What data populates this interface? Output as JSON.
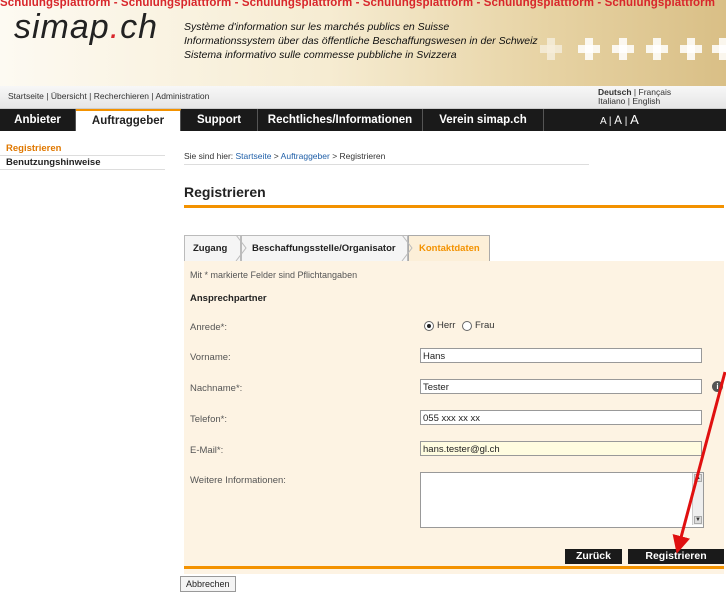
{
  "header": {
    "banner": "Schulungsplattform - Schulungsplattform - Schulungsplattform - Schulungsplattform - Schulungsplattform - Schulungsplattform",
    "logo_main": "simap",
    "logo_dot": ".",
    "logo_ext": "ch",
    "desc_fr": "Système d'information sur les marchés publics en Suisse",
    "desc_de": "Informationssystem über das öffentliche Beschaffungswesen in der Schweiz",
    "desc_it": "Sistema informativo sulle commesse pubbliche in Svizzera"
  },
  "toplinks": {
    "items": [
      "Startseite",
      "Übersicht",
      "Recherchieren",
      "Administration"
    ],
    "separator": "|"
  },
  "languages": {
    "deutsch": "Deutsch",
    "francais": "Français",
    "italiano": "Italiano",
    "english": "English",
    "sep": "|"
  },
  "nav": {
    "tabs": [
      "Anbieter",
      "Auftraggeber",
      "Support",
      "Rechtliches/Informationen",
      "Verein simap.ch"
    ],
    "font_small": "A",
    "font_mid": "A",
    "font_large": "A",
    "font_sep": "|"
  },
  "sidebar": {
    "items": [
      "Registrieren",
      "Benutzungshinweise"
    ]
  },
  "breadcrumb": {
    "prefix": "Sie sind hier:",
    "home": "Startseite",
    "sep": ">",
    "parent": "Auftraggeber",
    "current": "Registrieren"
  },
  "page_title": "Registrieren",
  "wizard": {
    "tabs": [
      "Zugang",
      "Beschaffungsstelle/Organisator",
      "Kontaktdaten"
    ]
  },
  "form": {
    "required_note": "Mit * markierte Felder sind Pflichtangaben",
    "section": "Ansprechpartner",
    "anrede_label": "Anrede*:",
    "anrede_herr": "Herr",
    "anrede_frau": "Frau",
    "vorname_label": "Vorname:",
    "vorname_value": "Hans",
    "nachname_label": "Nachname*:",
    "nachname_value": "Tester",
    "telefon_label": "Telefon*:",
    "telefon_value": "055 xxx xx xx",
    "email_label": "E-Mail*:",
    "email_value": "hans.tester@gl.ch",
    "weitere_label": "Weitere Informationen:",
    "weitere_value": ""
  },
  "buttons": {
    "back": "Zurück",
    "register": "Registrieren",
    "cancel": "Abbrechen"
  },
  "colors": {
    "accent": "#f39200",
    "brand_red": "#d8262b",
    "nav_bg": "#1a1a1a",
    "annotation_arrow": "#e01010"
  },
  "icons": {
    "info": "info-icon",
    "scroll_up": "scroll-up-icon",
    "scroll_down": "scroll-down-icon",
    "annotation": "red-arrow-annotation"
  }
}
